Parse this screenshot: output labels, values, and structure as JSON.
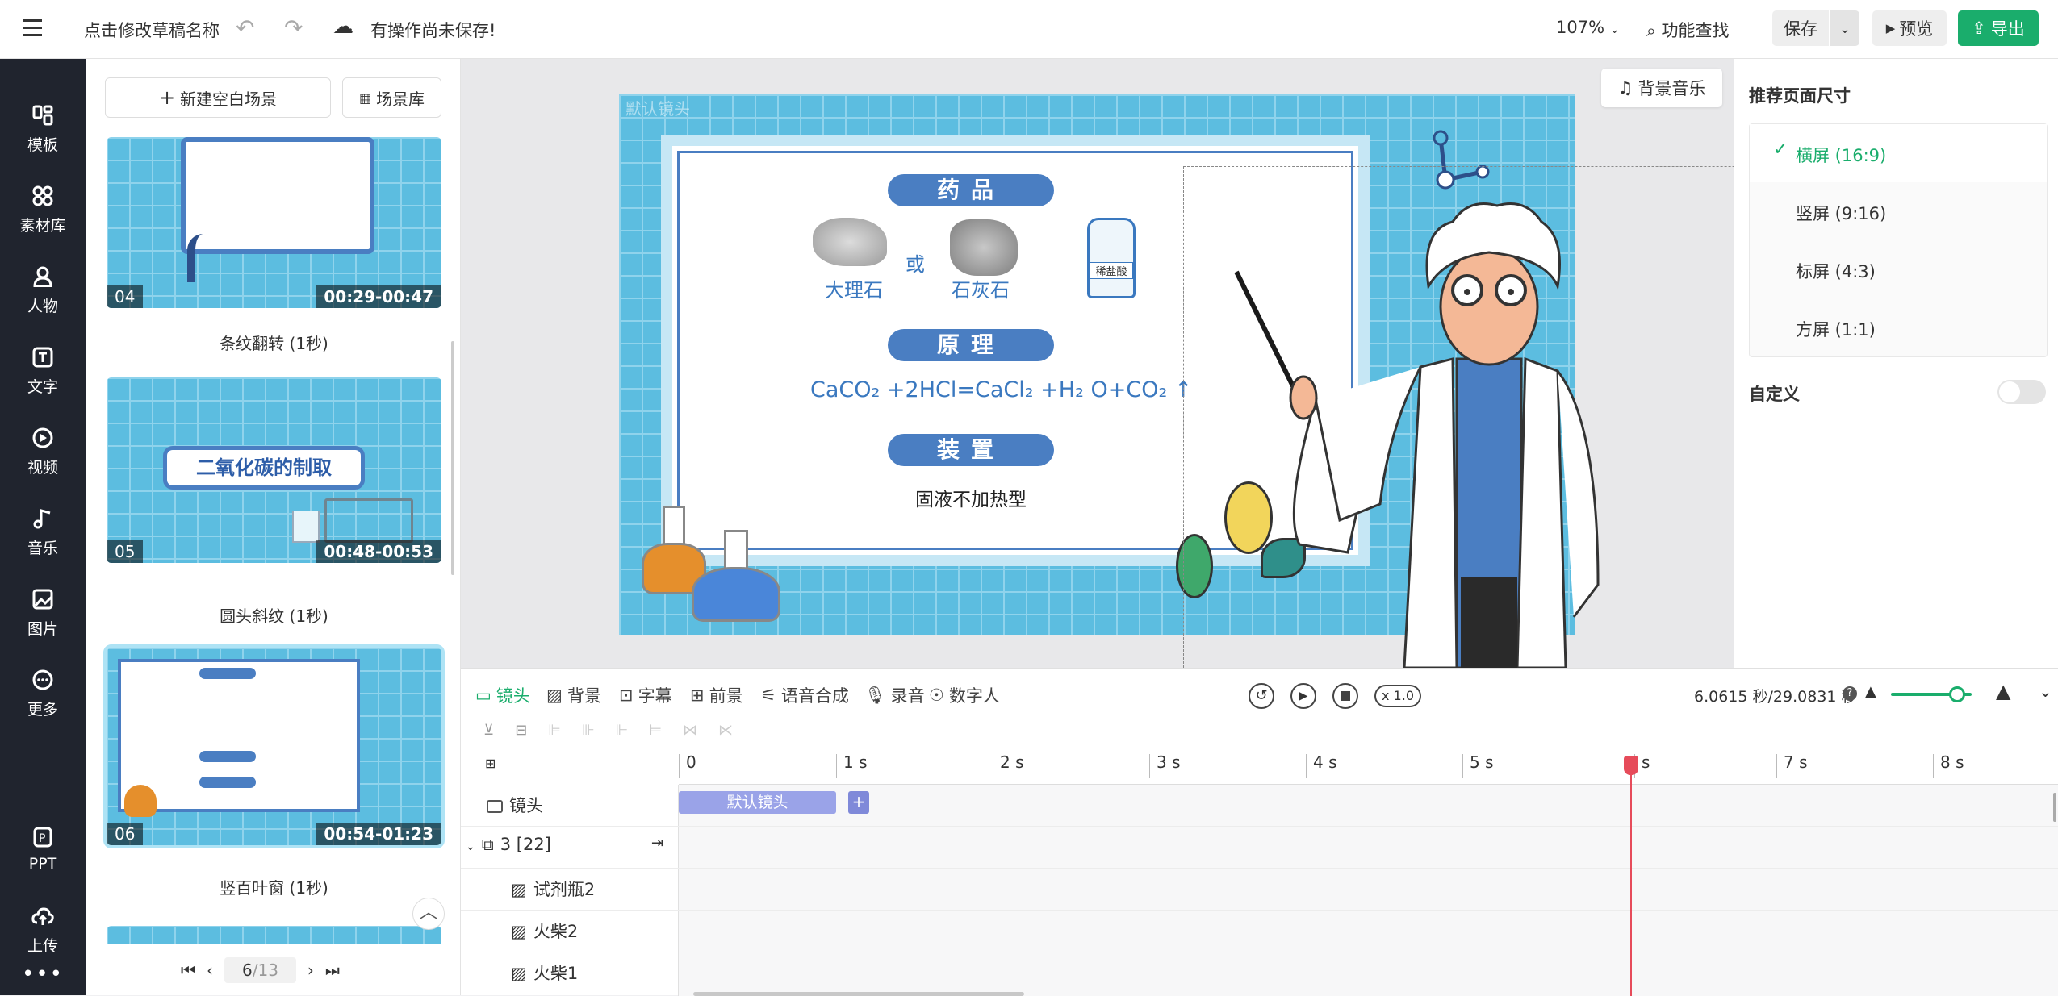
{
  "topbar": {
    "draft_name": "点击修改草稿名称",
    "unsaved_status": "有操作尚未保存!",
    "zoom": "107%",
    "feature_search": "功能查找",
    "save": "保存",
    "preview": "预览",
    "export": "导出"
  },
  "rail": {
    "items": [
      {
        "label": "模板",
        "icon": "template-icon"
      },
      {
        "label": "素材库",
        "icon": "material-icon"
      },
      {
        "label": "人物",
        "icon": "person-icon"
      },
      {
        "label": "文字",
        "icon": "text-icon"
      },
      {
        "label": "视频",
        "icon": "video-icon"
      },
      {
        "label": "音乐",
        "icon": "music-icon"
      },
      {
        "label": "图片",
        "icon": "image-icon"
      },
      {
        "label": "更多",
        "icon": "more-icon"
      },
      {
        "label": "PPT",
        "icon": "ppt-icon"
      },
      {
        "label": "上传",
        "icon": "upload-icon"
      }
    ]
  },
  "scenes": {
    "new_blank": "新建空白场景",
    "library": "场景库",
    "cards": [
      {
        "num": "04",
        "duration": "00:29-00:47",
        "transition": "条纹翻转 (1秒)"
      },
      {
        "num": "05",
        "duration": "00:48-00:53",
        "transition": "圆头斜纹 (1秒)",
        "banner": "二氧化碳的制取"
      },
      {
        "num": "06",
        "duration": "00:54-01:23",
        "transition": "竖百叶窗 (1秒)"
      }
    ],
    "pager": {
      "current": "6",
      "total": "/13"
    }
  },
  "canvas": {
    "camera_label": "默认镜头",
    "bg_music": "背景音乐",
    "title_drugs": "药品",
    "marble": "大理石",
    "or": "或",
    "limestone": "石灰石",
    "bottle_label": "稀盐酸",
    "title_principle": "原理",
    "equation": "CaCO₂ +2HCl=CaCl₂ +H₂ O+CO₂ ↑",
    "title_device": "装置",
    "device_type": "固液不加热型"
  },
  "rpanel": {
    "title": "推荐页面尺寸",
    "ratios": [
      "横屏 (16:9)",
      "竖屏 (9:16)",
      "标屏 (4:3)",
      "方屏 (1:1)"
    ],
    "selected_mark": "✓",
    "custom": "自定义"
  },
  "timeline": {
    "tabs": [
      "镜头",
      "背景",
      "字幕",
      "前景",
      "语音合成",
      "录音",
      "数字人"
    ],
    "speed": "x 1.0",
    "time_display": "6.0615 秒/29.0831 秒",
    "ticks": [
      "0",
      "1 s",
      "2 s",
      "3 s",
      "4 s",
      "5 s",
      "s",
      "7 s",
      "8 s"
    ],
    "tracks": {
      "camera": "镜头",
      "camera_clip": "默认镜头",
      "add": "+",
      "group": "3 [22]",
      "item1": "试剂瓶2",
      "item2": "火柴2",
      "item3": "火柴1"
    }
  },
  "colors": {
    "accent": "#1aad6c",
    "primary_blue": "#4a7ec2",
    "rail_bg": "#20242e",
    "clip": "#9aa3e8"
  }
}
